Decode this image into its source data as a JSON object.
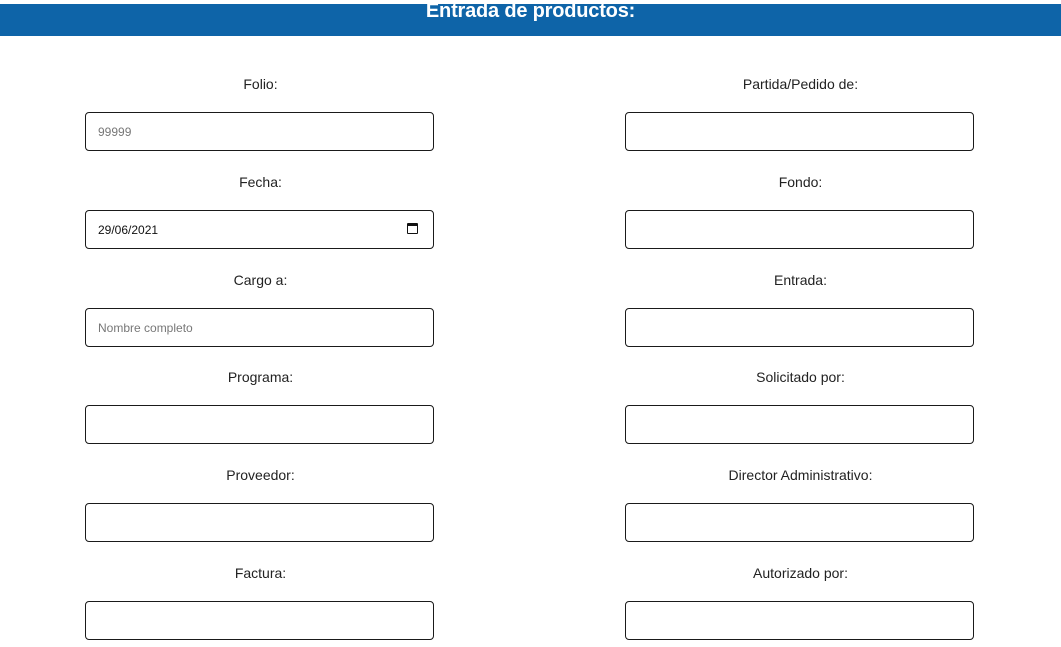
{
  "header": {
    "title": "Entrada de productos:"
  },
  "form": {
    "left": [
      {
        "label": "Folio:",
        "placeholder": "99999",
        "value": ""
      },
      {
        "label": "Fecha:",
        "placeholder": "",
        "value": "29/06/2021"
      },
      {
        "label": "Cargo a:",
        "placeholder": "Nombre completo",
        "value": ""
      },
      {
        "label": "Programa:",
        "placeholder": "",
        "value": ""
      },
      {
        "label": "Proveedor:",
        "placeholder": "",
        "value": ""
      },
      {
        "label": "Factura:",
        "placeholder": "",
        "value": ""
      }
    ],
    "right": [
      {
        "label": "Partida/Pedido de:",
        "placeholder": "",
        "value": ""
      },
      {
        "label": "Fondo:",
        "placeholder": "",
        "value": ""
      },
      {
        "label": "Entrada:",
        "placeholder": "",
        "value": ""
      },
      {
        "label": "Solicitado por:",
        "placeholder": "",
        "value": ""
      },
      {
        "label": "Director Administrativo:",
        "placeholder": "",
        "value": ""
      },
      {
        "label": "Autorizado por:",
        "placeholder": "",
        "value": ""
      }
    ]
  },
  "icons": {
    "date_picker": "calendar-icon"
  }
}
